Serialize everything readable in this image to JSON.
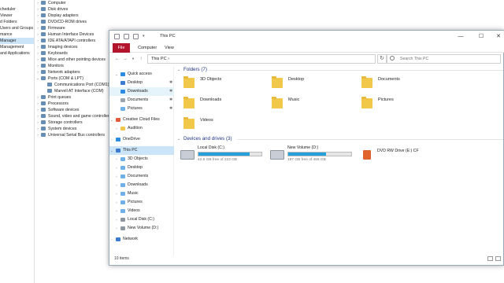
{
  "background": {
    "left_items": [
      "",
      "cheduler",
      "Viewer",
      "d Folders",
      "Users and Groups",
      "mance",
      "Manager",
      "Management",
      "and Applications"
    ],
    "tree": [
      {
        "label": "Computer",
        "child": false
      },
      {
        "label": "Disk drives",
        "child": false
      },
      {
        "label": "Display adapters",
        "child": false
      },
      {
        "label": "DVD/CD-ROM drives",
        "child": false
      },
      {
        "label": "Firmware",
        "child": false
      },
      {
        "label": "Human Interface Devices",
        "child": false
      },
      {
        "label": "IDE ATA/ATAPI controllers",
        "child": false
      },
      {
        "label": "Imaging devices",
        "child": false
      },
      {
        "label": "Keyboards",
        "child": false
      },
      {
        "label": "Mice and other pointing devices",
        "child": false
      },
      {
        "label": "Monitors",
        "child": false
      },
      {
        "label": "Network adapters",
        "child": false
      },
      {
        "label": "Ports (COM & LPT)",
        "child": false
      },
      {
        "label": "Communications Port (COM1)",
        "child": true
      },
      {
        "label": "Marvell AT Interface (COM)",
        "child": true
      },
      {
        "label": "Print queues",
        "child": false
      },
      {
        "label": "Processors",
        "child": false
      },
      {
        "label": "Software devices",
        "child": false
      },
      {
        "label": "Sound, video and game controllers",
        "child": false
      },
      {
        "label": "Storage controllers",
        "child": false
      },
      {
        "label": "System devices",
        "child": false
      },
      {
        "label": "Universal Serial Bus controllers",
        "child": false
      }
    ]
  },
  "window": {
    "title": "This PC",
    "minimize": "—",
    "maximize": "☐",
    "close": "✕",
    "tabs": {
      "file": "File",
      "computer": "Computer",
      "view": "View"
    },
    "address": "This PC  ›",
    "search_placeholder": "Search This PC",
    "status": "10 items"
  },
  "nav": {
    "quick_access": "Quick access",
    "items": [
      "Desktop",
      "Downloads",
      "Documents",
      "Pictures"
    ],
    "creative_cloud": "Creative Cloud Files",
    "audition": "Audition",
    "onedrive": "OneDrive",
    "this_pc": "This PC",
    "pc_items": [
      "3D Objects",
      "Desktop",
      "Documents",
      "Downloads",
      "Music",
      "Pictures",
      "Videos",
      "Local Disk (C:)",
      "New Volume (D:)"
    ],
    "network": "Network"
  },
  "content": {
    "folders_header": "Folders (7)",
    "folders": [
      "3D Objects",
      "Desktop",
      "Documents",
      "Downloads",
      "Music",
      "Pictures",
      "Videos"
    ],
    "drives_header": "Devices and drives (3)",
    "drives": [
      {
        "name": "Local Disk (C:)",
        "free": "42.5 GB free of 222 GB",
        "used": 0.81
      },
      {
        "name": "New Volume (D:)",
        "free": "187 GB free of 465 GB",
        "used": 0.6
      },
      {
        "name": "DVD RW Drive (E:) CF",
        "free": "",
        "used": null
      }
    ]
  },
  "colors": {
    "file_tab": "#b3152c",
    "drive_bar": "#26a0da",
    "selection": "#cce4f7"
  }
}
